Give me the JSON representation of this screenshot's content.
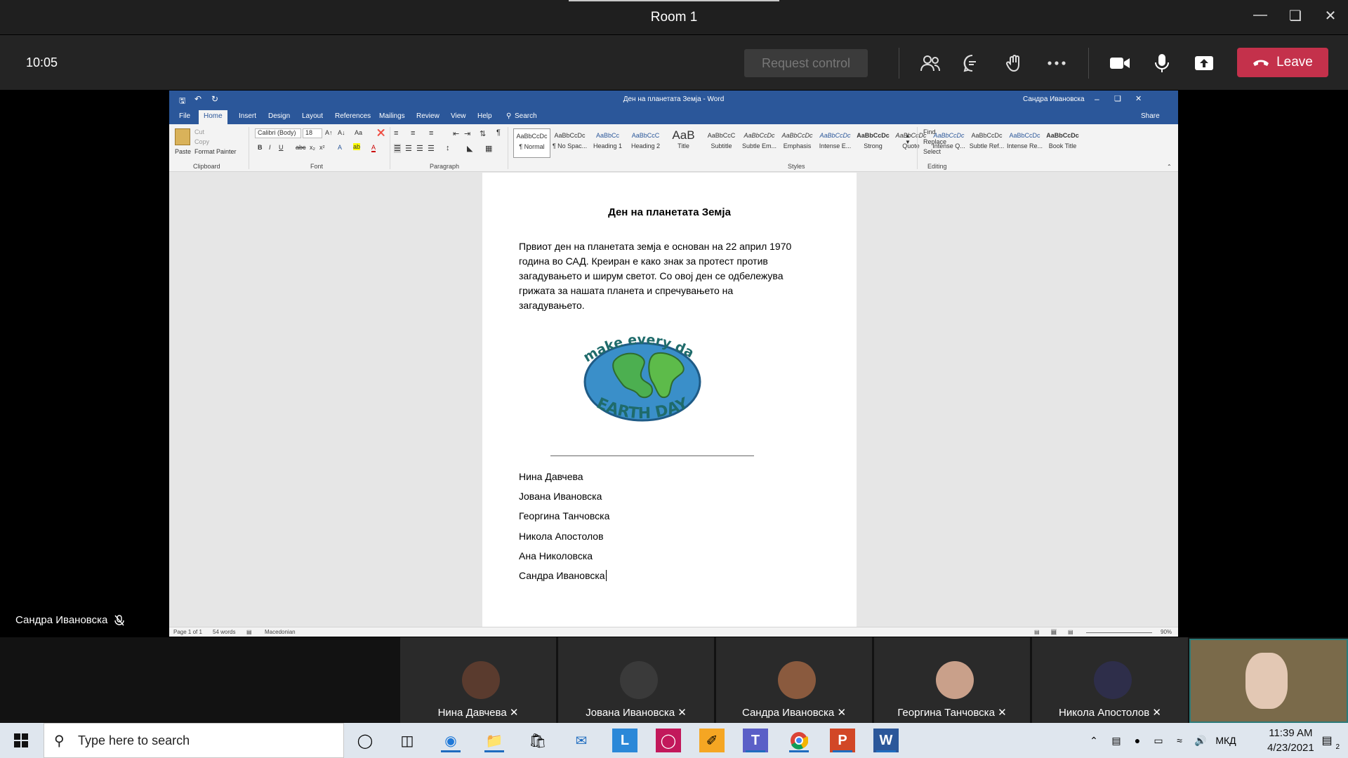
{
  "window": {
    "title": "Room 1"
  },
  "meeting": {
    "timer": "10:05",
    "request_control": "Request control",
    "leave": "Leave",
    "presenter_name": "Сандра Ивановска"
  },
  "word": {
    "title_doc": "Ден на планетата Земја  -  Word",
    "user": "Сандра Ивановска",
    "share": "Share",
    "tabs": [
      "File",
      "Home",
      "Insert",
      "Design",
      "Layout",
      "References",
      "Mailings",
      "Review",
      "View",
      "Help",
      "Search"
    ],
    "clipboard": {
      "paste": "Paste",
      "cut": "Cut",
      "copy": "Copy",
      "format_painter": "Format Painter",
      "label": "Clipboard"
    },
    "font": {
      "name": "Calibri (Body)",
      "size": "18",
      "label": "Font"
    },
    "paragraph_label": "Paragraph",
    "styles_label": "Styles",
    "editing_label": "Editing",
    "editing": {
      "find": "Find",
      "replace": "Replace",
      "select": "Select"
    },
    "styles": [
      {
        "preview": "AaBbCcDc",
        "name": "¶ Normal"
      },
      {
        "preview": "AaBbCcDc",
        "name": "¶ No Spac..."
      },
      {
        "preview": "AaBbCc",
        "name": "Heading 1"
      },
      {
        "preview": "AaBbCcC",
        "name": "Heading 2"
      },
      {
        "preview": "AaB",
        "name": "Title"
      },
      {
        "preview": "AaBbCcC",
        "name": "Subtitle"
      },
      {
        "preview": "AaBbCcDc",
        "name": "Subtle Em..."
      },
      {
        "preview": "AaBbCcDc",
        "name": "Emphasis"
      },
      {
        "preview": "AaBbCcDc",
        "name": "Intense E..."
      },
      {
        "preview": "AaBbCcDc",
        "name": "Strong"
      },
      {
        "preview": "AaBbCcDc",
        "name": "Quote"
      },
      {
        "preview": "AaBbCcDc",
        "name": "Intense Q..."
      },
      {
        "preview": "AaBbCcDc",
        "name": "Subtle Ref..."
      },
      {
        "preview": "AaBbCcDc",
        "name": "Intense Re..."
      },
      {
        "preview": "AaBbCcDc",
        "name": "Book Title"
      }
    ],
    "status": {
      "page": "Page 1 of 1",
      "words": "54 words",
      "language": "Macedonian",
      "zoom": "90%"
    }
  },
  "document": {
    "title": "Ден на планетата Земја",
    "body": "Првиот ден на планетата земја е основан на 22 април 1970 година во САД. Креиран е како знак за протест против загадувањето и ширум светот. Со овој ден се одбележува грижата за нашата планета и спречувањето на загадувањето.",
    "image_text_top": "make every day",
    "image_text_bottom": "EARTH DAY",
    "names": [
      "Нина Давчева",
      "Јована Ивановска",
      "Георгина Танчовска",
      "Никола Апостолов",
      "Ана Николовска",
      "Сандра Ивановска"
    ]
  },
  "participants": [
    {
      "name": "Нина Давчева"
    },
    {
      "name": "Јована Ивановска"
    },
    {
      "name": "Сандра Ивановска"
    },
    {
      "name": "Георгина Танчовска"
    },
    {
      "name": "Никола Апостолов"
    }
  ],
  "taskbar": {
    "search_placeholder": "Type here to search",
    "time": "11:39 AM",
    "date": "4/23/2021",
    "language": "МКД",
    "notifications": "2"
  }
}
